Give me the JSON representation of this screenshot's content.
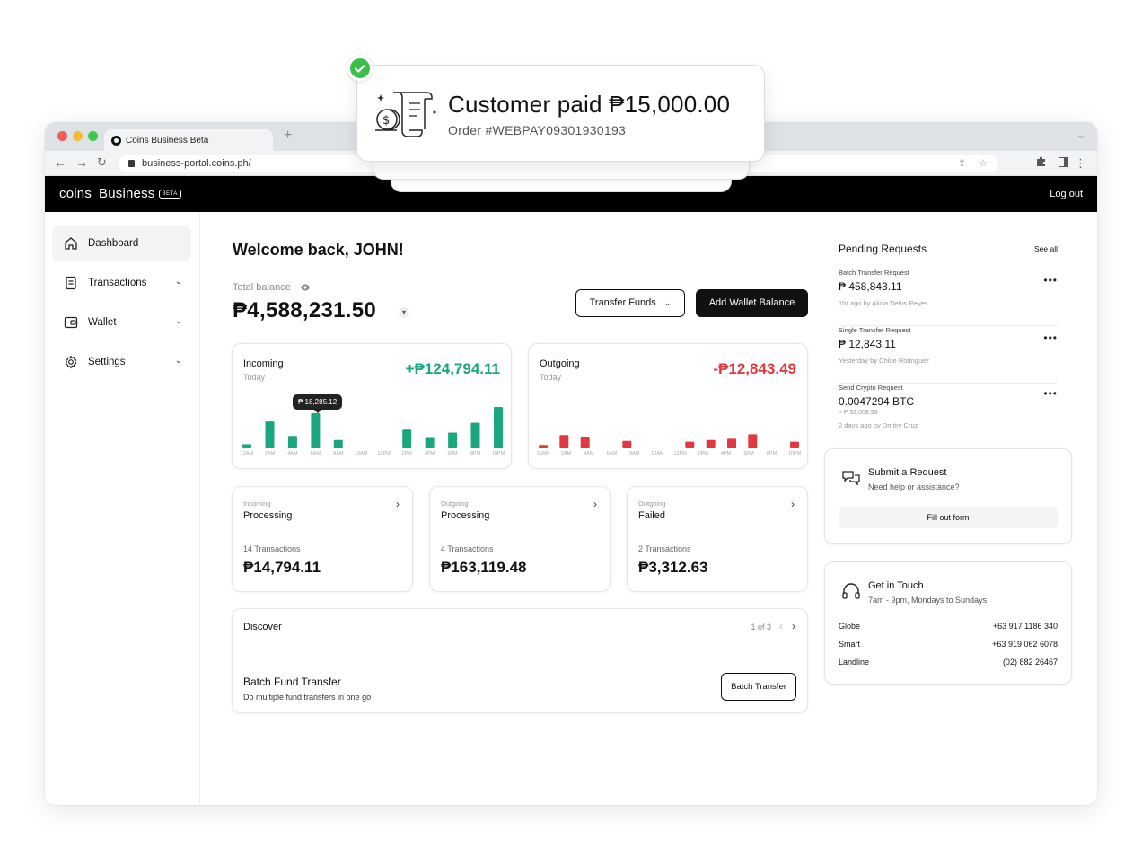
{
  "browser": {
    "tab_title": "Coins Business Beta",
    "new_tab": "+",
    "url": "business-portal.coins.ph/"
  },
  "header": {
    "logo_coins": "coins",
    "logo_business": "Business",
    "beta": "BETA",
    "logout": "Log out"
  },
  "sidebar": {
    "items": [
      {
        "label": "Dashboard",
        "icon": "home-icon",
        "active": true
      },
      {
        "label": "Transactions",
        "icon": "document-icon"
      },
      {
        "label": "Wallet",
        "icon": "wallet-icon"
      },
      {
        "label": "Settings",
        "icon": "gear-icon"
      }
    ]
  },
  "main": {
    "welcome": "Welcome back, JOHN!",
    "total_balance_label": "Total balance",
    "total_balance": "₱4,588,231.50",
    "transfer_funds": "Transfer Funds",
    "add_wallet_balance": "Add Wallet Balance",
    "incoming": {
      "title": "Incoming",
      "sub": "Today",
      "amount": "+₱124,794.11",
      "tooltip": "₱ 18,285.12"
    },
    "outgoing": {
      "title": "Outgoing",
      "sub": "Today",
      "amount": "-₱12,843.49"
    },
    "summary": [
      {
        "small": "Incoming",
        "title": "Processing",
        "count": "14 Transactions",
        "amount": "₱14,794.11"
      },
      {
        "small": "Outgoing",
        "title": "Processing",
        "count": "4 Transactions",
        "amount": "₱163,119.48"
      },
      {
        "small": "Outgoing",
        "title": "Failed",
        "count": "2 Transactions",
        "amount": "₱3,312.63"
      }
    ],
    "discover": {
      "title": "Discover",
      "page": "1 of 3",
      "heading": "Batch Fund Transfer",
      "desc": "Do multiple fund transfers in one go",
      "button": "Batch Transfer"
    }
  },
  "chart_data": [
    {
      "type": "bar",
      "categories": [
        "12AM",
        "2AM",
        "4AM",
        "6AM",
        "8AM",
        "10AM",
        "12PM",
        "2PM",
        "4PM",
        "6PM",
        "8PM",
        "10PM"
      ],
      "values": [
        1,
        6.5,
        3,
        8.5,
        2,
        0,
        0,
        4.5,
        2.5,
        3.8,
        6.2,
        10
      ],
      "ylim": [
        0,
        10
      ],
      "color": "#1aa67e"
    },
    {
      "type": "bar",
      "categories": [
        "12AM",
        "2AM",
        "4AM",
        "6AM",
        "8AM",
        "10AM",
        "12PM",
        "2PM",
        "4PM",
        "6PM",
        "8PM",
        "10PM"
      ],
      "values": [
        0.8,
        3.2,
        2.6,
        0,
        1.8,
        0,
        0,
        1.6,
        2,
        2.3,
        3.4,
        0,
        1.6
      ],
      "ylim": [
        0,
        10
      ],
      "color": "#e2383f"
    }
  ],
  "right": {
    "pending_title": "Pending Requests",
    "see_all": "See all",
    "requests": [
      {
        "type": "Batch Transfer Request",
        "amount": "₱ 458,843.11",
        "meta": "1hr ago by Alicia Delos Reyes"
      },
      {
        "type": "Single Transfer Request",
        "amount": "₱ 12,843.11",
        "meta": "Yesterday by Chloe Rodriguez"
      },
      {
        "type": "Send Crypto Request",
        "amount": "0.0047294 BTC",
        "sub": "≈ ₱ 32,008.93",
        "meta": "2 days ago by Dmitry Cruz"
      }
    ],
    "submit": {
      "title": "Submit a Request",
      "sub": "Need help or assistance?",
      "button": "Fill out form"
    },
    "touch": {
      "title": "Get in Touch",
      "sub": "7am - 9pm, Mondays to Sundays",
      "rows": [
        {
          "label": "Globe",
          "number": "+63 917 1186 340"
        },
        {
          "label": "Smart",
          "number": "+63 919 062 6078"
        },
        {
          "label": "Landline",
          "number": "(02) 882 26467"
        }
      ]
    }
  },
  "notification": {
    "title": "Customer paid ₱15,000.00",
    "order": "Order #WEBPAY09301930193"
  },
  "colors": {
    "incoming": "#1aa67e",
    "outgoing": "#e2383f",
    "check": "#3bbf4b"
  }
}
